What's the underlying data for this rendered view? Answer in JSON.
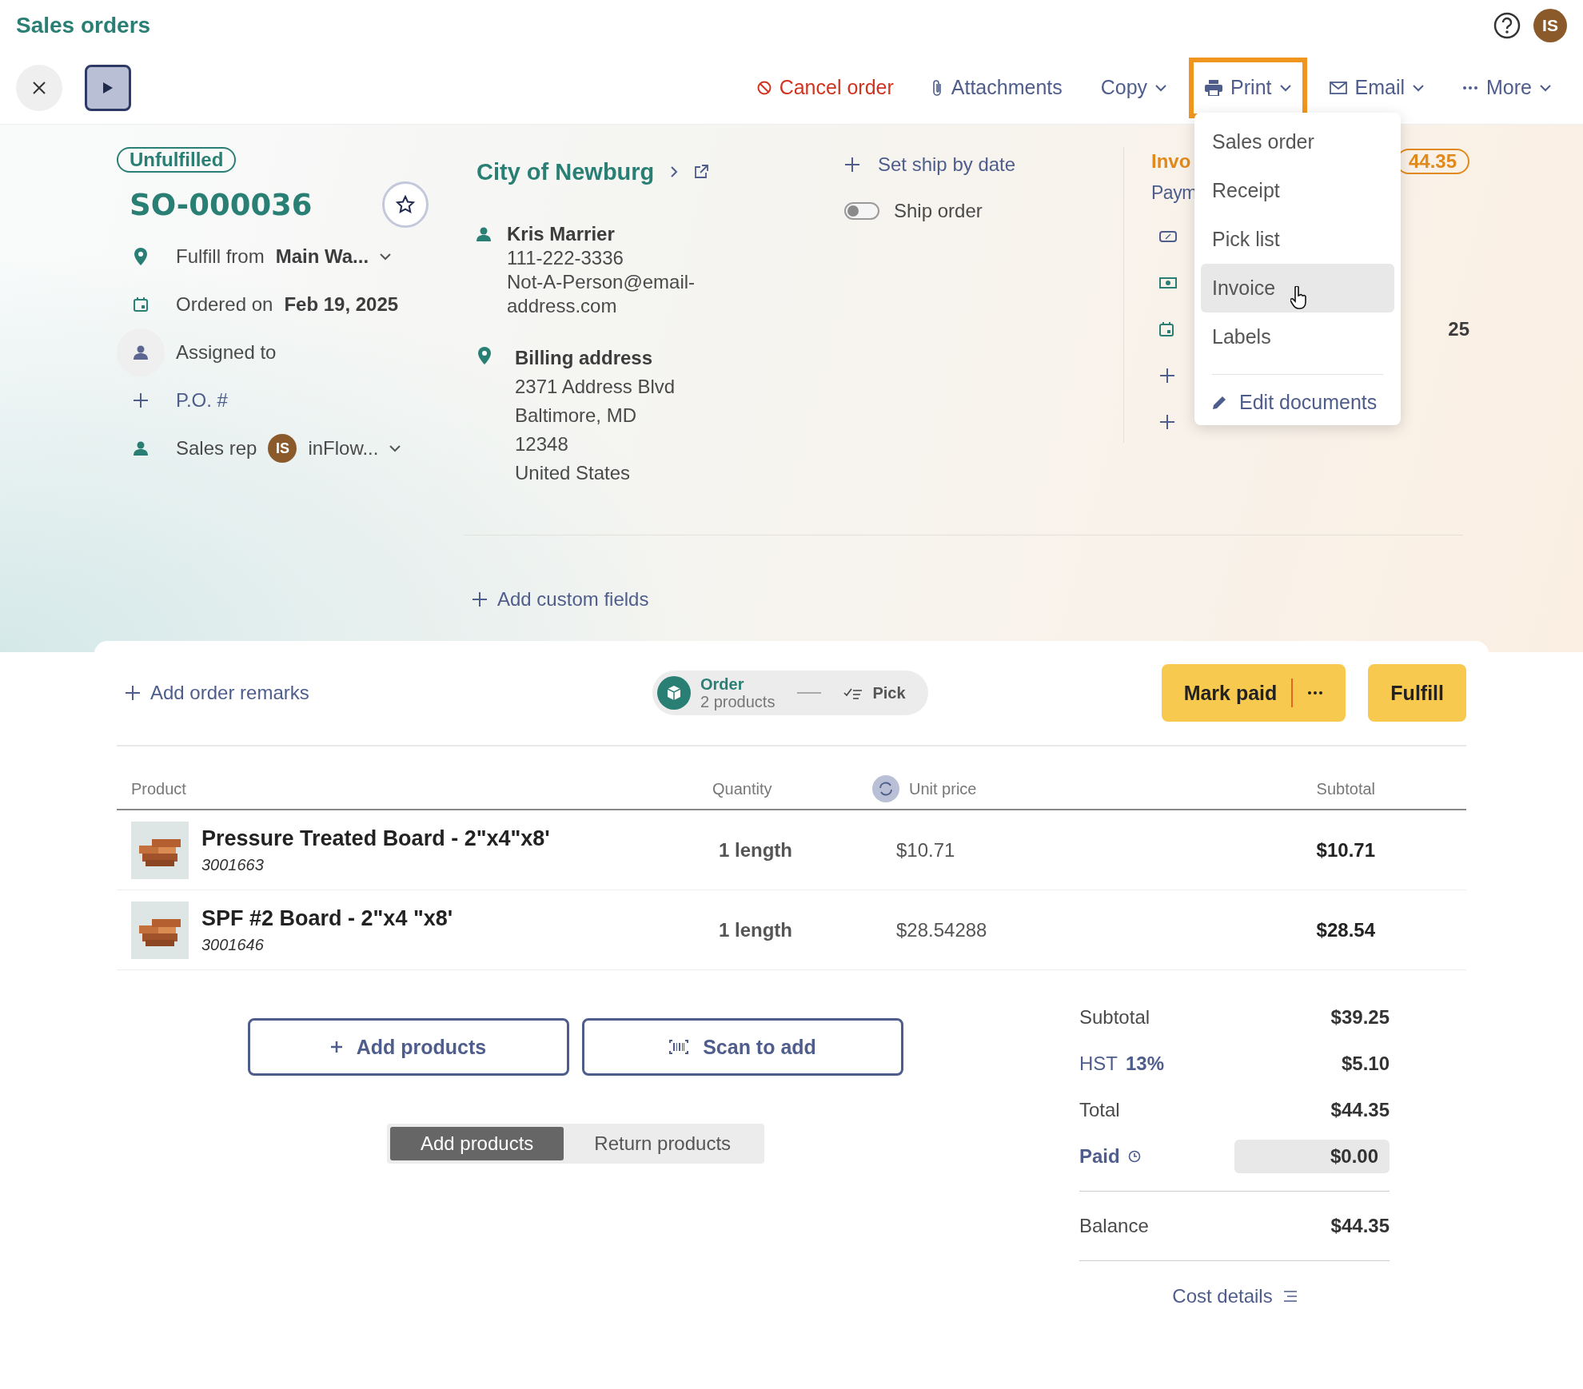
{
  "header": {
    "title": "Sales orders",
    "avatar": "IS"
  },
  "toolbar": {
    "actions": [
      {
        "kind": "cancel",
        "label": "Cancel order",
        "dropdown": false,
        "open": false
      },
      {
        "kind": "attach",
        "label": "Attachments",
        "dropdown": false,
        "open": false
      },
      {
        "kind": "copy",
        "label": "Copy",
        "dropdown": true,
        "open": false
      },
      {
        "kind": "print",
        "label": "Print",
        "dropdown": true,
        "open": true
      },
      {
        "kind": "email",
        "label": "Email",
        "dropdown": true,
        "open": false
      },
      {
        "kind": "more",
        "label": "More",
        "dropdown": true,
        "open": false
      }
    ]
  },
  "print_menu": {
    "items": [
      {
        "label": "Sales order",
        "selected": false
      },
      {
        "label": "Receipt",
        "selected": false
      },
      {
        "label": "Pick list",
        "selected": false
      },
      {
        "label": "Invoice",
        "selected": true
      },
      {
        "label": "Labels",
        "selected": false
      }
    ],
    "edit_link": "Edit documents"
  },
  "order": {
    "status": "Unfulfilled",
    "number": "SO-000036",
    "starred": false,
    "fields": [
      {
        "kind": "location",
        "label": "Fulfill from",
        "value": "Main Wa..."
      },
      {
        "kind": "date",
        "label": "Ordered on",
        "value": "Feb 19, 2025"
      },
      {
        "kind": "assign",
        "label": "Assigned to"
      },
      {
        "kind": "add",
        "label": "P.O. #"
      },
      {
        "kind": "rep",
        "label": "Sales rep",
        "avatar": "IS",
        "value": "inFlow..."
      }
    ]
  },
  "customer": {
    "name": "City of Newburg",
    "contact_name": "Kris Marrier",
    "phone": "111-222-3336",
    "email": "Not-A-Person@email-address.com",
    "billing_label": "Billing address",
    "billing_lines": [
      "2371 Address Blvd",
      "Baltimore, MD",
      "12348",
      "United States"
    ]
  },
  "shipping": {
    "set_date": "Set ship by date",
    "ship_order": {
      "label": "Ship order",
      "on": false
    }
  },
  "invoice": {
    "title": "Invo",
    "amount": "44.35",
    "payment": "Paym",
    "rows": [
      {
        "kind": "discount"
      },
      {
        "kind": "money"
      },
      {
        "kind": "date",
        "value": "25"
      },
      {
        "kind": "add"
      },
      {
        "kind": "add"
      }
    ]
  },
  "custom_fields": "Add custom fields",
  "remarks": "Add order remarks",
  "progress": [
    {
      "label": "Order",
      "sub": "2 products",
      "active": true
    },
    {
      "label": "Pick",
      "active": false
    }
  ],
  "actions": {
    "mark_paid": "Mark paid",
    "fulfill": "Fulfill"
  },
  "table": {
    "columns": [
      "Product",
      "Quantity",
      "Unit price",
      "Subtotal"
    ],
    "rows": [
      {
        "name": "Pressure Treated Board - 2\"x4\"x8'",
        "sku": "3001663",
        "quantity": "1 length",
        "unit_price": "$10.71",
        "subtotal": "$10.71"
      },
      {
        "name": "SPF #2 Board - 2\"x4 \"x8'",
        "sku": "3001646",
        "quantity": "1 length",
        "unit_price": "$28.54288",
        "subtotal": "$28.54"
      }
    ]
  },
  "add_buttons": [
    {
      "kind": "add",
      "label": "Add products"
    },
    {
      "kind": "scan",
      "label": "Scan to add"
    }
  ],
  "mode_tabs": [
    {
      "label": "Add products",
      "selected": true
    },
    {
      "label": "Return products",
      "selected": false
    }
  ],
  "summary": [
    {
      "kind": "plain",
      "label": "Subtotal",
      "value": "$39.25"
    },
    {
      "kind": "tax",
      "label": "HST",
      "rate": "13%",
      "value": "$5.10"
    },
    {
      "kind": "plain",
      "label": "Total",
      "value": "$44.35"
    },
    {
      "kind": "paid",
      "label": "Paid",
      "value": "$0.00"
    },
    {
      "kind": "balance",
      "label": "Balance",
      "value": "$44.35"
    }
  ],
  "cost_details": "Cost details"
}
